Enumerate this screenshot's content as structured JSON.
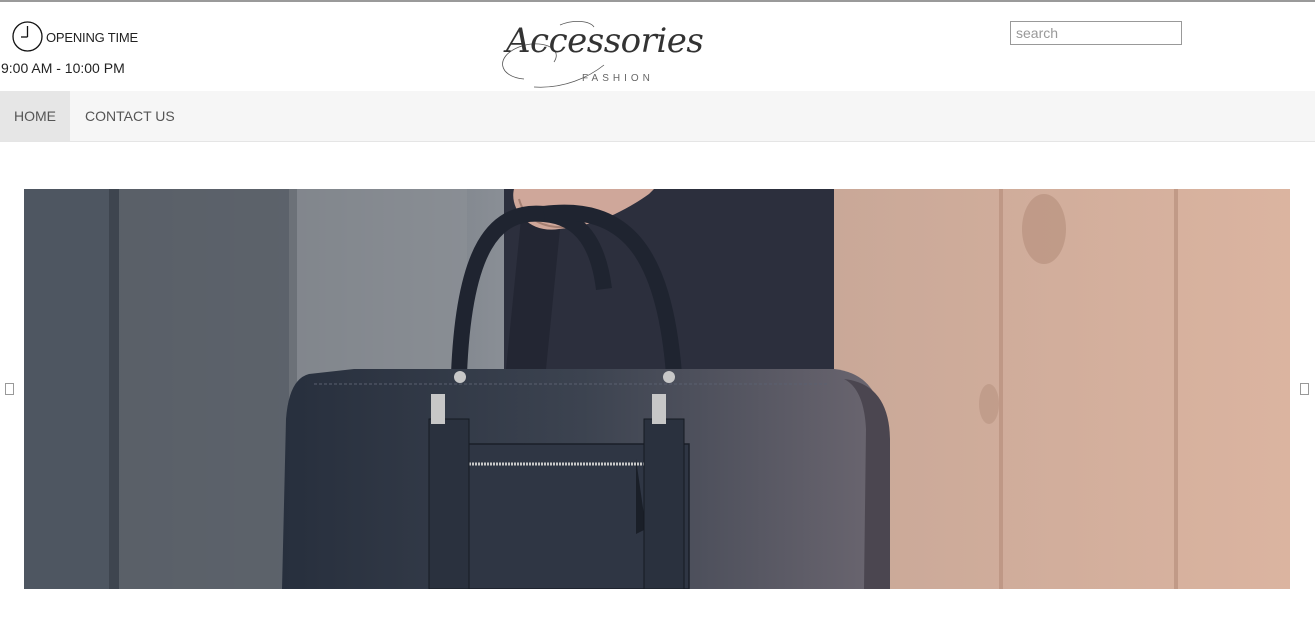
{
  "header": {
    "opening_label": "OPENING TIME",
    "opening_hours": "9:00 AM - 10:00 PM",
    "logo_script": "Accessories",
    "logo_sub": "FASHION",
    "search": {
      "placeholder": "search",
      "value": ""
    }
  },
  "nav": {
    "items": [
      {
        "label": "HOME",
        "active": true
      },
      {
        "label": "CONTACT US",
        "active": false
      }
    ]
  },
  "slider": {
    "icons": {
      "prev": "chevron-left-icon",
      "next": "chevron-right-icon"
    }
  },
  "colors": {
    "nav_bg": "#f6f6f6",
    "nav_active_bg": "#e6e6e6",
    "text": "#555555"
  }
}
